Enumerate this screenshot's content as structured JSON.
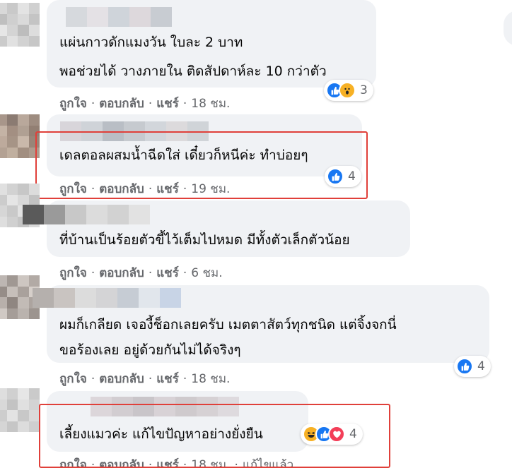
{
  "action_labels": {
    "like": "ถูกใจ",
    "reply": "ตอบกลับ",
    "share": "แชร์",
    "sep": "·"
  },
  "comments": [
    {
      "lines": [
        "แผ่นกาวดักแมงวัน ใบละ 2 บาท",
        "พอช่วยได้ วางภายใน ติดสัปดาห์ละ 10 กว่าตัว"
      ],
      "time": "18 ชม.",
      "reactions": [
        "like",
        "wow"
      ],
      "reaction_count": "3",
      "highlighted": false
    },
    {
      "lines": [
        "เดลตอลผสมน้ำฉีดใส่ เดี๋ยวก็หนีค่ะ ทำบ่อยๆ"
      ],
      "time": "19 ชม.",
      "reactions": [
        "like"
      ],
      "reaction_count": "4",
      "highlighted": true
    },
    {
      "lines": [
        "ที่บ้านเป็นร้อยตัวขี้ไว้เต็มไปหมด มีทั้งตัวเล็กตัวน้อย"
      ],
      "time": "6 ชม.",
      "reactions": [],
      "reaction_count": "",
      "highlighted": false
    },
    {
      "lines": [
        "ผมก็เกลียด เจองี้ช็อกเลยครับ เมตตาสัตว์ทุกชนิด แต่จิ้งจกนี่",
        "ขอร้องเลย อยู่ด้วยกันไม่ได้จริงๆ"
      ],
      "time": "18 ชม.",
      "reactions": [
        "like"
      ],
      "reaction_count": "4",
      "highlighted": false
    },
    {
      "lines": [
        "เลี้ยงแมวค่ะ แก้ไขปัญหาอย่างยั่งยืน"
      ],
      "time": "18 ชม.",
      "edited": "แก้ไขแล้ว",
      "reactions": [
        "haha",
        "like",
        "love"
      ],
      "reaction_count": "4",
      "highlighted": true
    }
  ],
  "colors": {
    "bubble": "#f0f2f5",
    "highlight_border": "#e0403a",
    "like_blue": "#1877f2",
    "meta_gray": "#65676b"
  }
}
